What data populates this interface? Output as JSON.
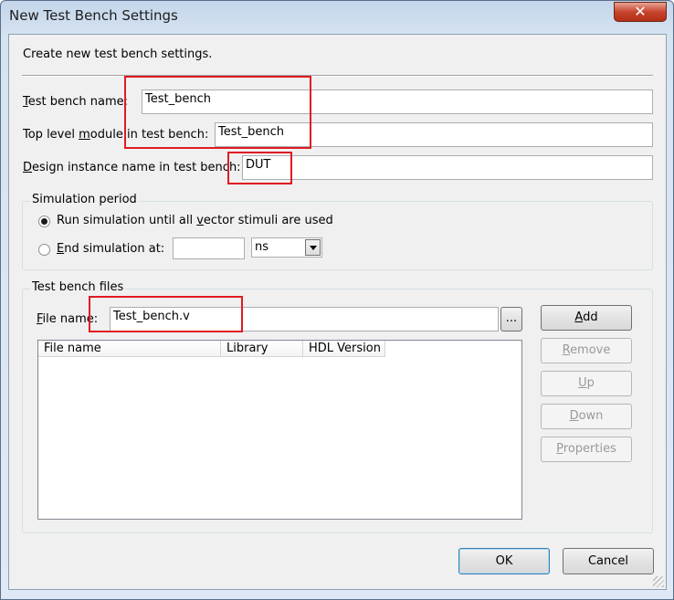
{
  "window": {
    "title": "New Test Bench Settings",
    "close_glyph": "✕"
  },
  "intro": "Create new test bench settings.",
  "fields": {
    "tb_name": {
      "label_u": "T",
      "label_rest": "est bench name:",
      "value": "Test_bench"
    },
    "top_module": {
      "label_a": "Top level ",
      "label_u": "m",
      "label_b": "odule in test bench:",
      "value": "Test_bench"
    },
    "instance": {
      "label_u": "D",
      "label_rest": "esign instance name in test bench:",
      "value": "DUT"
    }
  },
  "simulation": {
    "title": "Simulation period",
    "opt_all_a": "Run simulation until all ",
    "opt_all_u": "v",
    "opt_all_b": "ector stimuli are used",
    "opt_end_u": "E",
    "opt_end_rest": "nd simulation at:",
    "end_value": "",
    "unit": "ns",
    "selected": "all"
  },
  "files": {
    "title": "Test bench files",
    "file_label_u": "F",
    "file_label_rest": "ile name:",
    "file_value": "Test_bench.v",
    "browse": "...",
    "columns": [
      "File name",
      "Library",
      "HDL Version"
    ],
    "rows": []
  },
  "buttons": {
    "add_u": "A",
    "add_rest": "dd",
    "remove_u": "R",
    "remove_rest": "emove",
    "up_u": "U",
    "up_rest": "p",
    "down_u": "D",
    "down_rest": "own",
    "properties_u": "P",
    "properties_rest": "roperties",
    "ok": "OK",
    "cancel": "Cancel"
  },
  "colors": {
    "highlight": "#e01b22"
  }
}
